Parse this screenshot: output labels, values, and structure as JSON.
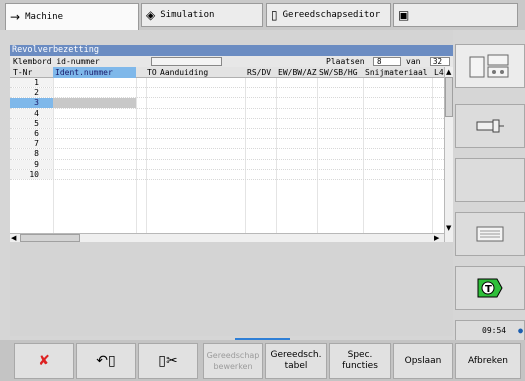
{
  "tabs": [
    {
      "icon": "→",
      "label": "Machine",
      "active": true
    },
    {
      "icon": "◈",
      "label": "Simulation",
      "active": false
    },
    {
      "icon": "▯",
      "label": "Gereedschapseditor",
      "active": false
    },
    {
      "icon": "▣",
      "label": "",
      "active": false
    }
  ],
  "panel": {
    "title": "Revolverbezetting",
    "clipboard_label": "Klembord id-nummer",
    "clipboard_value": "",
    "places_label": "Plaatsen",
    "places_value": "8",
    "of_label": "van",
    "of_value": "32"
  },
  "table": {
    "columns": [
      "T-Nr",
      "Ident.nummer",
      "TO",
      "Aanduiding",
      "RS/DV",
      "EW/BW/AZ",
      "SW/SB/HG",
      "Snijmateriaal",
      "L4"
    ],
    "rows": [
      "1",
      "2",
      "3",
      "4",
      "5",
      "6",
      "7",
      "8",
      "9",
      "10"
    ],
    "selected_row": "3"
  },
  "side_keys": [
    {
      "icon": "turret-view-icon"
    },
    {
      "icon": "tool-holder-icon"
    },
    {
      "icon": ""
    },
    {
      "icon": "tool-list-icon"
    },
    {
      "icon": "tool-T-icon"
    },
    {
      "icon": ""
    }
  ],
  "clock": "09:54",
  "bottom_keys": [
    {
      "label": "",
      "icon": "delete-tool-icon",
      "enabled": true
    },
    {
      "label": "",
      "icon": "load-tool-icon",
      "enabled": true
    },
    {
      "label": "",
      "icon": "cut-tool-icon",
      "enabled": true
    },
    {
      "label": "Gereedschap bewerken",
      "enabled": false
    },
    {
      "label": "Gereedsch. tabel",
      "enabled": true
    },
    {
      "label": "Spec. functies",
      "enabled": true
    },
    {
      "label": "Opslaan",
      "enabled": true
    },
    {
      "label": "Afbreken",
      "enabled": true
    }
  ]
}
